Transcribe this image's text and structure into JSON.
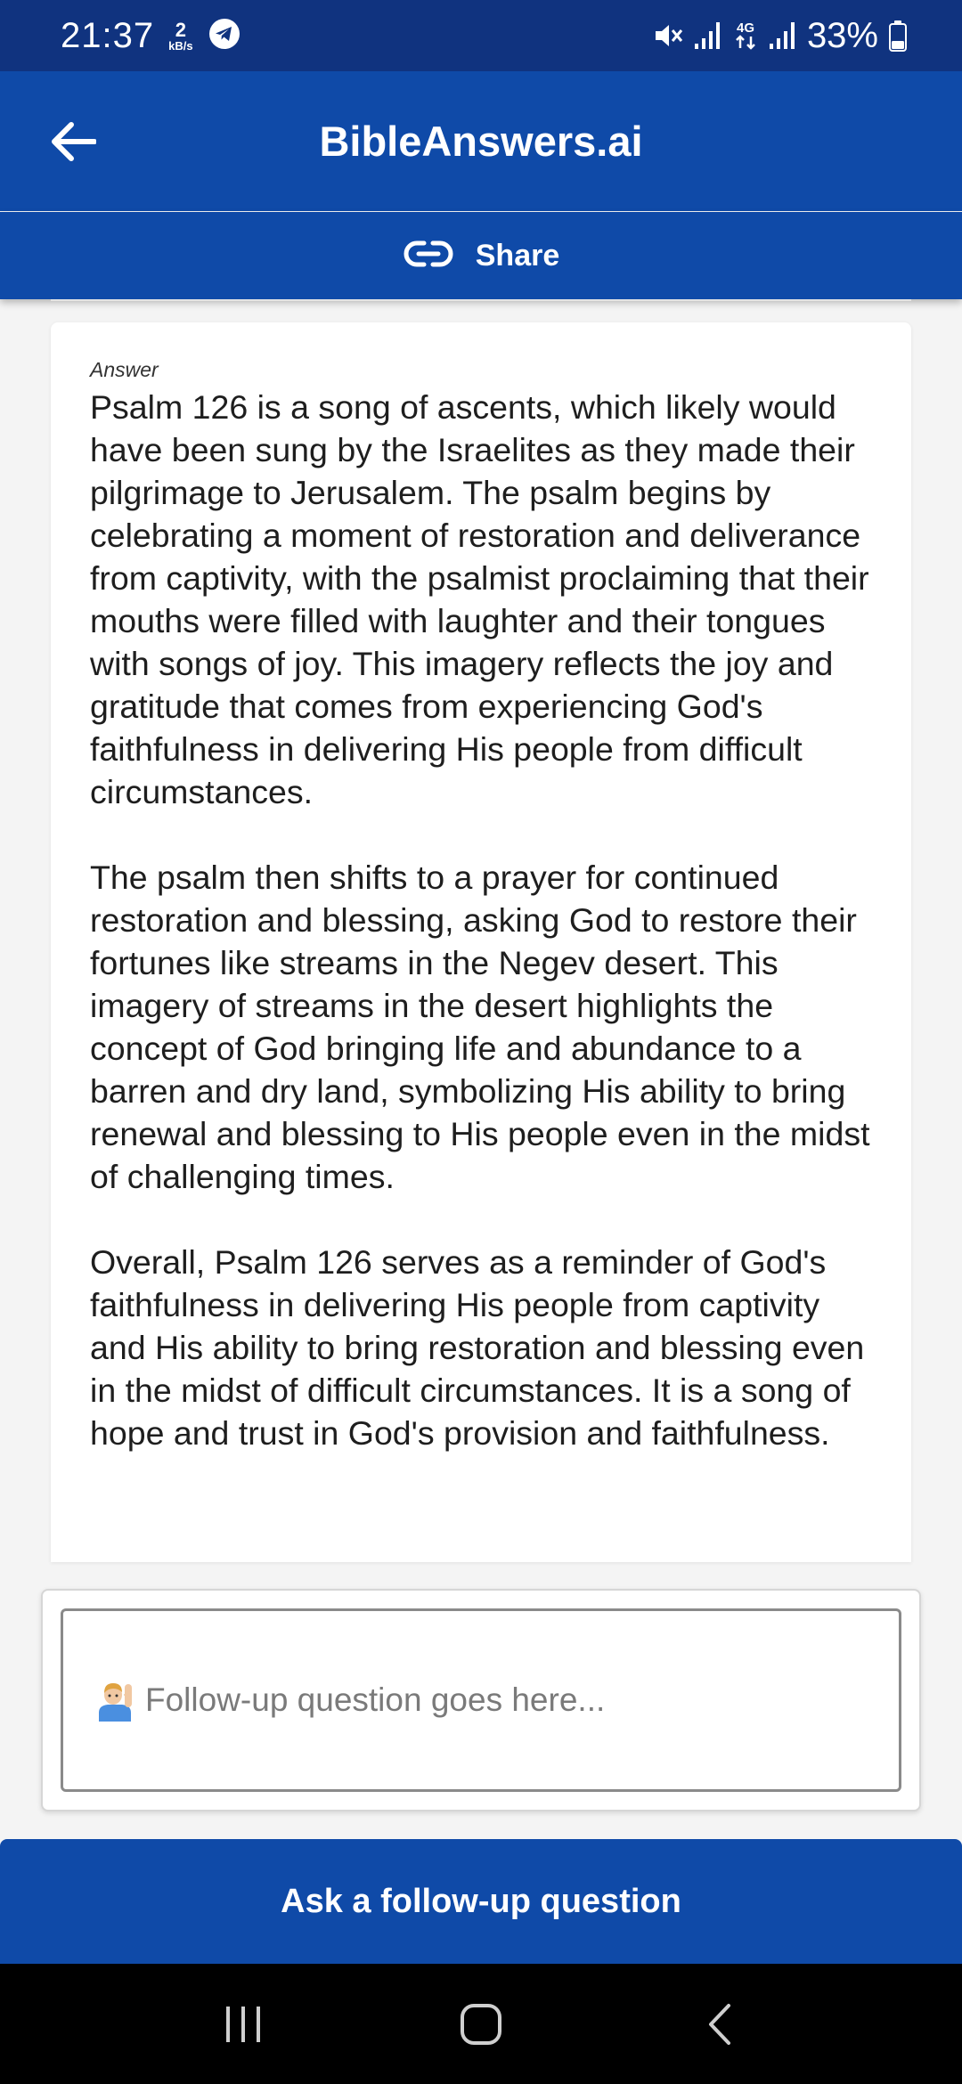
{
  "status_bar": {
    "time": "21:37",
    "data_rate_value": "2",
    "data_rate_unit": "kB/s",
    "network_type": "4G",
    "battery_percent": "33%",
    "icons": [
      "telegram-icon",
      "mute-icon",
      "signal-icon",
      "network-4g-icon",
      "signal-icon",
      "battery-icon"
    ]
  },
  "app_bar": {
    "title": "BibleAnswers.ai",
    "back_icon": "arrow-left-icon"
  },
  "share_bar": {
    "label": "Share",
    "icon": "link-icon"
  },
  "answer": {
    "label": "Answer",
    "paragraphs": [
      "Psalm 126 is a song of ascents, which likely would have been sung by the Israelites as they made their pilgrimage to Jerusalem. The psalm begins by celebrating a moment of restoration and deliverance from captivity, with the psalmist proclaiming that their mouths were filled with laughter and their tongues with songs of joy. This imagery reflects the joy and gratitude that comes from experiencing God's faithfulness in delivering His people from difficult circumstances.",
      "The psalm then shifts to a prayer for continued restoration and blessing, asking God to restore their fortunes like streams in the Negev desert. This imagery of streams in the desert highlights the concept of God bringing life and abundance to a barren and dry land, symbolizing His ability to bring renewal and blessing to His people even in the midst of challenging times.",
      "Overall, Psalm 126 serves as a reminder of God's faithfulness in delivering His people from captivity and His ability to bring restoration and blessing even in the midst of difficult circumstances. It is a song of hope and trust in God's provision and faithfulness."
    ]
  },
  "follow_up": {
    "placeholder": "Follow-up question goes here...",
    "value": "",
    "emoji_icon": "person-raising-hand-icon",
    "button_label": "Ask a follow-up question"
  },
  "nav_bar": {
    "icons": [
      "recent-apps-icon",
      "home-icon",
      "back-icon"
    ]
  },
  "colors": {
    "status_bar": "#10337f",
    "primary": "#0f4aa8",
    "background": "#f4f4f4",
    "nav_bar": "#000000"
  }
}
